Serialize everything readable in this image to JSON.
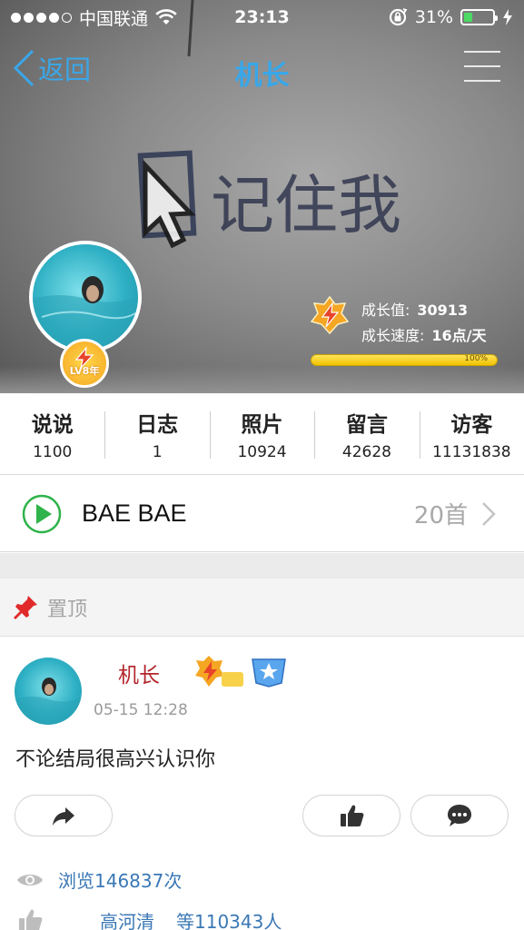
{
  "status_bar": {
    "carrier": "中国联通",
    "time": "23:13",
    "battery_percent": "31%",
    "battery_level": 0.31,
    "signal_bars_filled": 4,
    "signal_bars_total": 5
  },
  "nav": {
    "back_label": "返回",
    "title": "机长"
  },
  "cover": {
    "background_text": "记住我"
  },
  "avatar": {
    "level_badge": "LV8年"
  },
  "growth": {
    "value_label": "成长值:",
    "value": "30913",
    "speed_label": "成长速度:",
    "speed": "16点/天",
    "progress_label": "100%",
    "progress": 1.0
  },
  "stats": [
    {
      "label": "说说",
      "value": "1100"
    },
    {
      "label": "日志",
      "value": "1"
    },
    {
      "label": "照片",
      "value": "10924"
    },
    {
      "label": "留言",
      "value": "42628"
    },
    {
      "label": "访客",
      "value": "11131838"
    }
  ],
  "music": {
    "song": "BAE BAE",
    "count": "20首"
  },
  "pinned": {
    "label": "置顶"
  },
  "post": {
    "author": "机长",
    "time": "05-15 12:28",
    "text": "不论结局很高兴认识你",
    "views": "浏览146837次",
    "liker_name": "高河清",
    "likers_count": "等110343人"
  },
  "colors": {
    "accent_blue": "#39a7e9",
    "author_red": "#b2262b",
    "link_blue": "#3a78b5",
    "play_green": "#2fb34a",
    "badge_orange": "#f5a623"
  }
}
